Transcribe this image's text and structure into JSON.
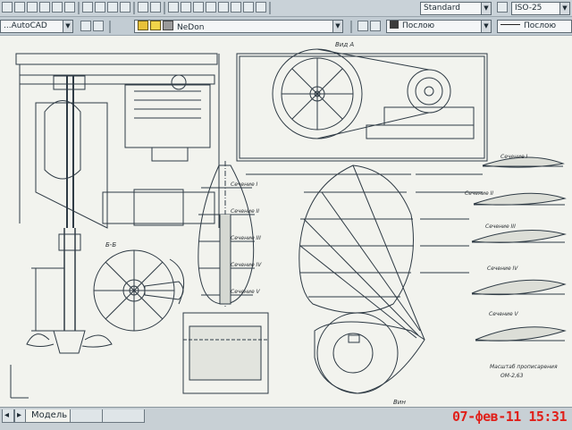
{
  "toolbar": {
    "text_style": "Standard",
    "dim_style": "ISO-25"
  },
  "layers_bar": {
    "app_combo": "...AutoCAD",
    "layer_name": "NeDon",
    "linetype": "Послою",
    "lineweight": "Послою"
  },
  "drawing": {
    "view_a": "Вид А",
    "view_bb": "Б-Б",
    "view_bottom": "Вин",
    "sections": [
      "Сечение I",
      "Сечение II",
      "Сечение III",
      "Сечение IV",
      "Сечение V"
    ],
    "blade_sections": [
      "Сечение I",
      "Сечение II",
      "Сечение III",
      "Сечение IV",
      "Сечение V"
    ],
    "caption_line1": "Масштаб прописарения",
    "caption_line2": "ОМ-2,63"
  },
  "tabs": {
    "model": "Модель"
  },
  "timestamp": "07-фев-11 15:31",
  "colors": {
    "stamp": "#e0201a",
    "canvas": "#f2f3ee",
    "ink": "#2f3b45"
  }
}
